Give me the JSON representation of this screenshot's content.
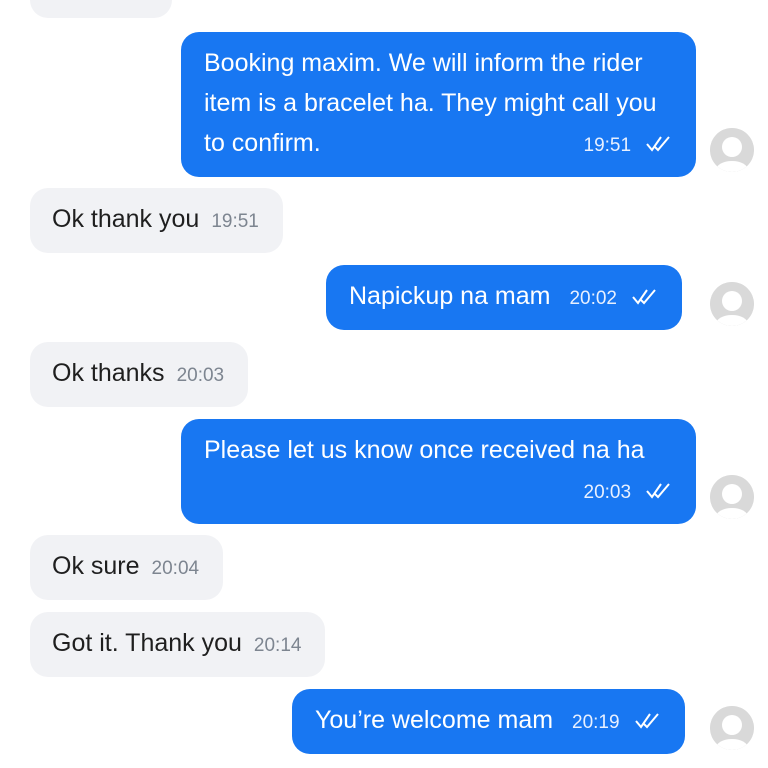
{
  "conversation": {
    "messages": [
      {
        "direction": "outgoing",
        "text": "Booking maxim. We will inform the rider item is a bracelet ha. They might call you to confirm.",
        "time": "19:51",
        "status": "sent"
      },
      {
        "direction": "incoming",
        "text": "Ok thank you",
        "time": "19:51"
      },
      {
        "direction": "outgoing",
        "text": "Napickup na mam",
        "time": "20:02",
        "status": "sent"
      },
      {
        "direction": "incoming",
        "text": "Ok thanks",
        "time": "20:03"
      },
      {
        "direction": "outgoing",
        "text": "Please let us know once received na ha",
        "time": "20:03",
        "status": "sent"
      },
      {
        "direction": "incoming",
        "text": "Ok sure",
        "time": "20:04"
      },
      {
        "direction": "incoming",
        "text": "Got it. Thank you",
        "time": "20:14"
      },
      {
        "direction": "outgoing",
        "text": "You’re welcome mam",
        "time": "20:19",
        "status": "sent"
      }
    ]
  },
  "icons": {
    "read_receipt": "double-check-icon",
    "avatar": "default-avatar-icon"
  },
  "colors": {
    "outgoing_bubble": "#1877f2",
    "incoming_bubble": "#f1f2f5",
    "incoming_text": "#1f1f1f",
    "timestamp": "#7d8590"
  }
}
